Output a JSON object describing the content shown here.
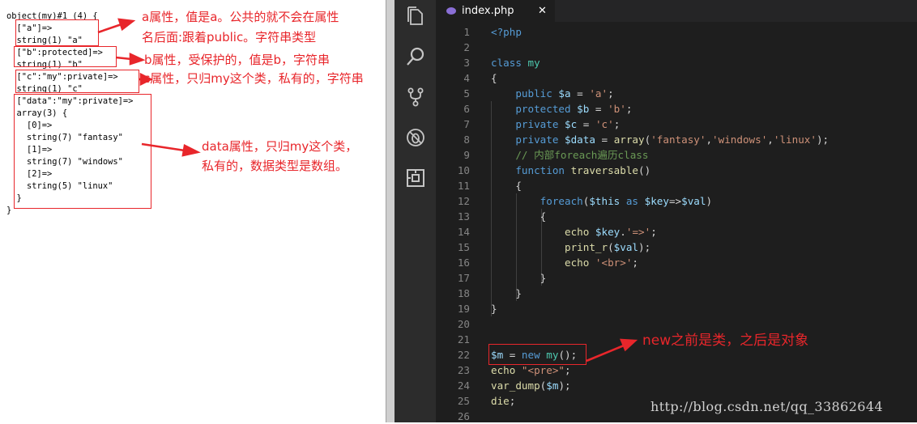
{
  "dump_lines": [
    "object(my)#1 (4) {",
    "  [\"a\"]=>",
    "  string(1) \"a\"",
    "  [\"b\":protected]=>",
    "  string(1) \"b\"",
    "  [\"c\":\"my\":private]=>",
    "  string(1) \"c\"",
    "  [\"data\":\"my\":private]=>",
    "  array(3) {",
    "    [0]=>",
    "    string(7) \"fantasy\"",
    "    [1]=>",
    "    string(7) \"windows\"",
    "    [2]=>",
    "    string(5) \"linux\"",
    "  }",
    "}"
  ],
  "annotations": {
    "a_line1": "a属性，值是a。公共的就不会在属性",
    "a_line2": "名后面:跟着public。字符串类型",
    "b": "b属性，受保护的，值是b，字符串",
    "c": "c属性，只归my这个类，私有的，字符串",
    "data_line1": "data属性，只归my这个类，",
    "data_line2": "私有的，数据类型是数组。",
    "new": "new之前是类，之后是对象"
  },
  "annotation_color": "#e8262b",
  "editor": {
    "tab_title": "index.php",
    "tab_close": "✕",
    "activity_icons": [
      "files-icon",
      "search-icon",
      "source-control-icon",
      "debug-icon",
      "extensions-icon"
    ],
    "lines": [
      [
        [
          "<?php",
          "tag"
        ]
      ],
      [],
      [
        [
          "class ",
          "kw"
        ],
        [
          "my",
          "cls"
        ]
      ],
      [
        [
          "{",
          "p"
        ]
      ],
      [
        [
          "    "
        ],
        [
          "public ",
          "kw"
        ],
        [
          "$a",
          "var"
        ],
        [
          " = ",
          "p"
        ],
        [
          "'a'",
          "str"
        ],
        [
          ";",
          "p"
        ]
      ],
      [
        [
          "    "
        ],
        [
          "protected ",
          "kw"
        ],
        [
          "$b",
          "var"
        ],
        [
          " = ",
          "p"
        ],
        [
          "'b'",
          "str"
        ],
        [
          ";",
          "p"
        ]
      ],
      [
        [
          "    "
        ],
        [
          "private ",
          "kw"
        ],
        [
          "$c",
          "var"
        ],
        [
          " = ",
          "p"
        ],
        [
          "'c'",
          "str"
        ],
        [
          ";",
          "p"
        ]
      ],
      [
        [
          "    "
        ],
        [
          "private ",
          "kw"
        ],
        [
          "$data",
          "var"
        ],
        [
          " = ",
          "p"
        ],
        [
          "array",
          "fn"
        ],
        [
          "(",
          "p"
        ],
        [
          "'fantasy'",
          "str"
        ],
        [
          ",",
          "p"
        ],
        [
          "'windows'",
          "str"
        ],
        [
          ",",
          "p"
        ],
        [
          "'linux'",
          "str"
        ],
        [
          ");",
          "p"
        ]
      ],
      [
        [
          "    "
        ],
        [
          "// 内部foreach遍历class",
          "cmt"
        ]
      ],
      [
        [
          "    "
        ],
        [
          "function ",
          "kw"
        ],
        [
          "traversable",
          "fn"
        ],
        [
          "()",
          "p"
        ]
      ],
      [
        [
          "    "
        ],
        [
          "{",
          "p"
        ]
      ],
      [
        [
          "        "
        ],
        [
          "foreach",
          "kw"
        ],
        [
          "(",
          "p"
        ],
        [
          "$this",
          "var"
        ],
        [
          " as ",
          "kw"
        ],
        [
          "$key",
          "var"
        ],
        [
          "=>",
          "p"
        ],
        [
          "$val",
          "var"
        ],
        [
          ")",
          "p"
        ]
      ],
      [
        [
          "        "
        ],
        [
          "{",
          "p"
        ]
      ],
      [
        [
          "            "
        ],
        [
          "echo ",
          "fn"
        ],
        [
          "$key",
          "var"
        ],
        [
          ".",
          "p"
        ],
        [
          "'=>'",
          "str"
        ],
        [
          ";",
          "p"
        ]
      ],
      [
        [
          "            "
        ],
        [
          "print_r",
          "fn"
        ],
        [
          "(",
          "p"
        ],
        [
          "$val",
          "var"
        ],
        [
          ");",
          "p"
        ]
      ],
      [
        [
          "            "
        ],
        [
          "echo ",
          "fn"
        ],
        [
          "'<br>'",
          "str"
        ],
        [
          ";",
          "p"
        ]
      ],
      [
        [
          "        "
        ],
        [
          "}",
          "p"
        ]
      ],
      [
        [
          "    "
        ],
        [
          "}",
          "p"
        ]
      ],
      [
        [
          "}",
          "p"
        ]
      ],
      [],
      [],
      [
        [
          "$m",
          "var"
        ],
        [
          " = ",
          "p"
        ],
        [
          "new ",
          "kw"
        ],
        [
          "my",
          "cls"
        ],
        [
          "();",
          "p"
        ]
      ],
      [
        [
          "echo ",
          "fn"
        ],
        [
          "\"<pre>\"",
          "str"
        ],
        [
          ";",
          "p"
        ]
      ],
      [
        [
          "var_dump",
          "fn"
        ],
        [
          "(",
          "p"
        ],
        [
          "$m",
          "var"
        ],
        [
          ");",
          "p"
        ]
      ],
      [
        [
          "die",
          "fn"
        ],
        [
          ";",
          "p"
        ]
      ],
      []
    ],
    "colors": {
      "tag": "#569cd6",
      "kw": "#569cd6",
      "cls": "#4ec9b0",
      "var": "#9cdcfe",
      "str": "#ce9178",
      "fn": "#dcdcaa",
      "cmt": "#6a9955",
      "p": "#d4d4d4"
    }
  },
  "watermark": "http://blog.csdn.net/qq_33862644"
}
